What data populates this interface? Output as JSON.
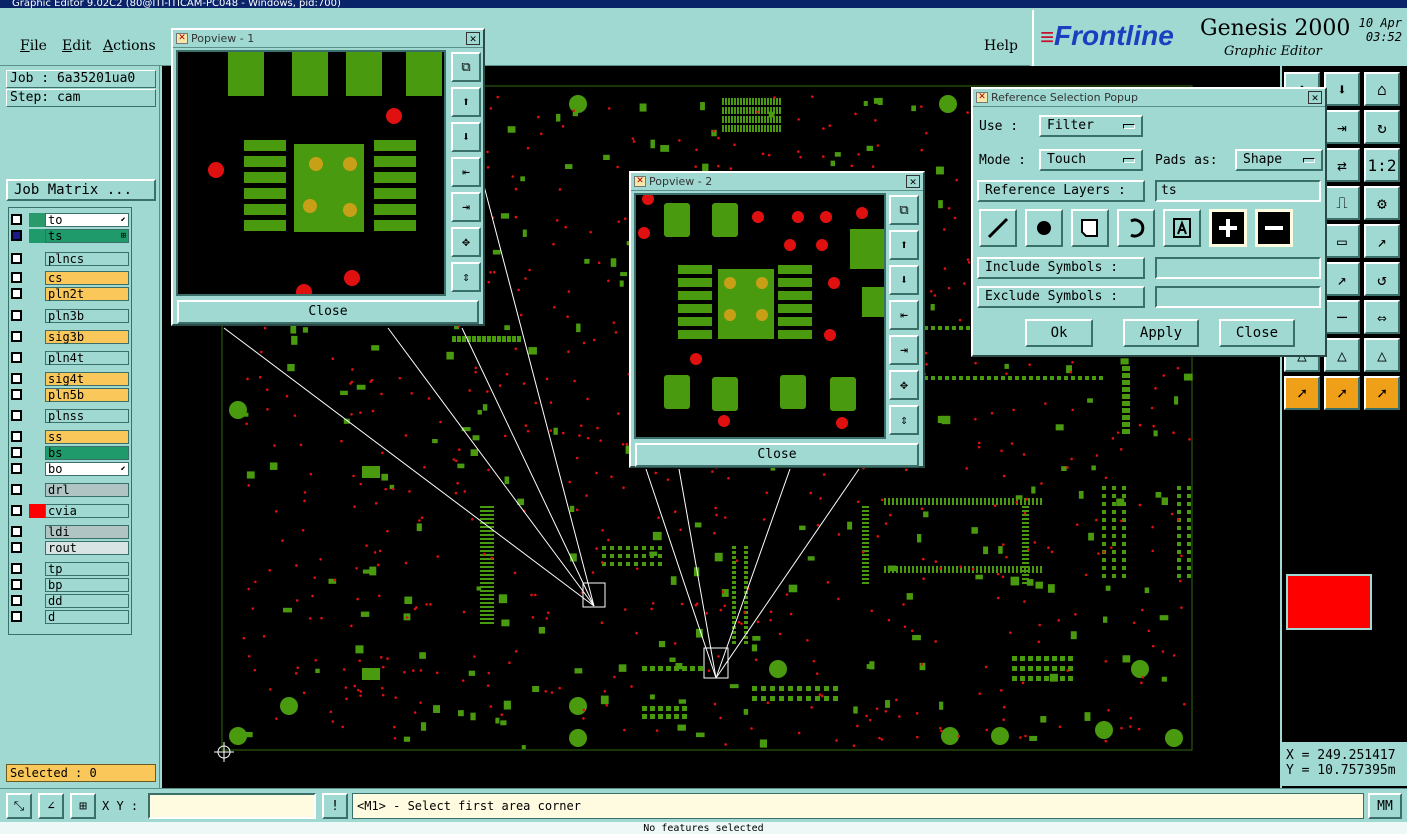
{
  "window_title": "Graphic Editor 9.02C2 (80@ITI-ITICAM-PC048 - Windows, pid:700)",
  "menu": [
    {
      "label": "File",
      "ul": "F",
      "rest": "ile"
    },
    {
      "label": "Edit",
      "ul": "E",
      "rest": "dit"
    },
    {
      "label": "Actions",
      "ul": "A",
      "rest": "ctions"
    },
    {
      "label": "Help",
      "ul": "",
      "rest": "Help"
    }
  ],
  "brand": {
    "logo": "Frontline",
    "product": "Genesis 2000",
    "subtitle": "Graphic Editor",
    "date": "10 Apr",
    "time": "03:52"
  },
  "job": {
    "job_label": "Job : 6a35201ua0",
    "step_label": "Step: cam",
    "matrix_button": "Job Matrix ..."
  },
  "layers": [
    {
      "name": "to",
      "color": "#ffffff",
      "swatch": "#2a9a6a",
      "active": false,
      "mark": "⬋"
    },
    {
      "name": "ts",
      "color": "#1f9a6a",
      "swatch": "#1f9a6a",
      "active": true,
      "mark": "⊞"
    },
    {
      "name": "plncs",
      "color": "#9fd9d2",
      "swatch": "#9fd9d2"
    },
    {
      "name": "cs",
      "color": "#fac85a",
      "swatch": "#9fd9d2"
    },
    {
      "name": "pln2t",
      "color": "#fac85a",
      "swatch": "#9fd9d2"
    },
    {
      "name": "pln3b",
      "color": "#9fd9d2",
      "swatch": "#9fd9d2"
    },
    {
      "name": "sig3b",
      "color": "#fac85a",
      "swatch": "#9fd9d2"
    },
    {
      "name": "pln4t",
      "color": "#9fd9d2",
      "swatch": "#9fd9d2"
    },
    {
      "name": "sig4t",
      "color": "#fac85a",
      "swatch": "#9fd9d2"
    },
    {
      "name": "pln5b",
      "color": "#fac85a",
      "swatch": "#9fd9d2"
    },
    {
      "name": "plnss",
      "color": "#9fd9d2",
      "swatch": "#9fd9d2"
    },
    {
      "name": "ss",
      "color": "#fac85a",
      "swatch": "#9fd9d2"
    },
    {
      "name": "bs",
      "color": "#1f9a6a",
      "swatch": "#9fd9d2"
    },
    {
      "name": "bo",
      "color": "#ffffff",
      "swatch": "#9fd9d2",
      "mark": "⬋"
    },
    {
      "name": "drl",
      "color": "#b0c4c4",
      "swatch": "#9fd9d2"
    },
    {
      "name": "cvia",
      "color": "#9fd9d2",
      "swatch": "#ff0000"
    },
    {
      "name": "ldi",
      "color": "#b0c4c4",
      "swatch": "#9fd9d2"
    },
    {
      "name": "rout",
      "color": "#d8e4e4",
      "swatch": "#9fd9d2"
    },
    {
      "name": "tp",
      "color": "#9fd9d2",
      "swatch": "#9fd9d2"
    },
    {
      "name": "bp",
      "color": "#9fd9d2",
      "swatch": "#9fd9d2"
    },
    {
      "name": "dd",
      "color": "#9fd9d2",
      "swatch": "#9fd9d2"
    },
    {
      "name": "d",
      "color": "#9fd9d2",
      "swatch": "#9fd9d2"
    }
  ],
  "selected": "Selected : 0",
  "popview1": {
    "title": "Popview - 1",
    "close_label": "Close"
  },
  "popview2": {
    "title": "Popview - 2",
    "close_label": "Close"
  },
  "ref_popup": {
    "title": "Reference Selection Popup",
    "use_label": "Use   :",
    "use_value": "Filter",
    "mode_label": "Mode  :",
    "mode_value": "Touch",
    "pads_label": "Pads as:",
    "pads_value": "Shape",
    "ref_layers_label": "Reference Layers :",
    "ref_layers_value": "ts",
    "include_label": "Include Symbols :",
    "include_value": "",
    "exclude_label": "Exclude Symbols :",
    "exclude_value": "",
    "ok_label": "Ok",
    "apply_label": "Apply",
    "close_label": "Close"
  },
  "coords": {
    "x": "X = 249.251417",
    "y": "Y = 10.757395m"
  },
  "status": {
    "xy_label": "X Y :",
    "xy_value": "",
    "prompt": "<M1> - Select first area corner",
    "units": "MM",
    "bottom": "No features selected"
  },
  "colors": {
    "panel": "#9fd9d2",
    "pad": "#4a9a10",
    "via": "#ff0000",
    "layer_orange": "#fac85a"
  }
}
